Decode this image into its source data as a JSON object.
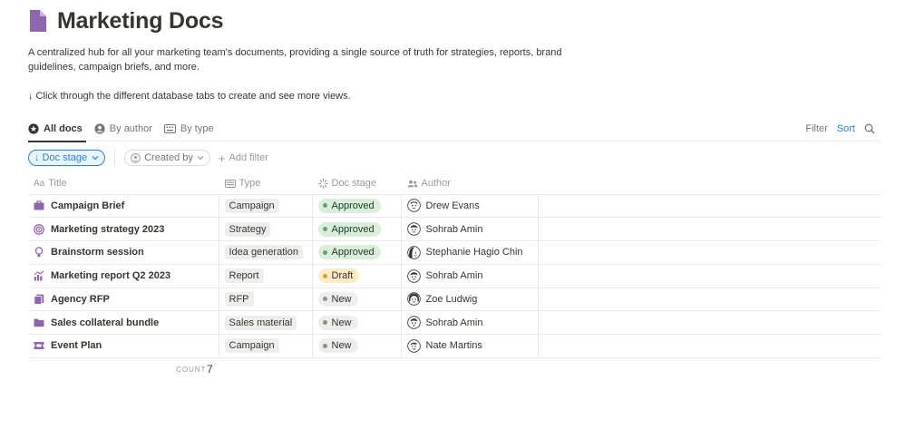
{
  "page": {
    "icon": "document-icon",
    "title": "Marketing Docs",
    "description": "A centralized hub for all your marketing team's documents, providing a single source of truth for strategies, reports, brand guidelines, campaign briefs, and more.",
    "hint": "↓ Click through the different database tabs to create and see more views."
  },
  "views": {
    "tabs": [
      {
        "label": "All docs",
        "icon": "star-circle-icon",
        "active": true
      },
      {
        "label": "By author",
        "icon": "person-icon",
        "active": false
      },
      {
        "label": "By type",
        "icon": "keyboard-icon",
        "active": false
      }
    ],
    "filter_label": "Filter",
    "sort_label": "Sort",
    "search_icon": "search-icon"
  },
  "filters": {
    "sort_chip": "↓ Doc stage",
    "created_by": "Created by",
    "add_filter": "Add filter"
  },
  "table": {
    "columns": [
      {
        "label": "Title",
        "icon_text": "Aa"
      },
      {
        "label": "Type",
        "icon": "list-icon"
      },
      {
        "label": "Doc stage",
        "icon": "loader-icon"
      },
      {
        "label": "Author",
        "icon": "people-icon"
      }
    ],
    "rows": [
      {
        "title": "Campaign Brief",
        "icon": "briefcase-icon",
        "type": "Campaign",
        "stage": "Approved",
        "author": "Drew Evans"
      },
      {
        "title": "Marketing strategy 2023",
        "icon": "target-icon",
        "type": "Strategy",
        "stage": "Approved",
        "author": "Sohrab Amin"
      },
      {
        "title": "Brainstorm session",
        "icon": "lightbulb-icon",
        "type": "Idea generation",
        "stage": "Approved",
        "author": "Stephanie Hagio Chin"
      },
      {
        "title": "Marketing report Q2 2023",
        "icon": "chart-icon",
        "type": "Report",
        "stage": "Draft",
        "author": "Sohrab Amin"
      },
      {
        "title": "Agency RFP",
        "icon": "documents-icon",
        "type": "RFP",
        "stage": "New",
        "author": "Zoe Ludwig"
      },
      {
        "title": "Sales collateral bundle",
        "icon": "folder-icon",
        "type": "Sales material",
        "stage": "New",
        "author": "Sohrab Amin"
      },
      {
        "title": "Event Plan",
        "icon": "ticket-icon",
        "type": "Campaign",
        "stage": "New",
        "author": "Nate Martins"
      }
    ],
    "count_label": "COUNT",
    "count_value": "7"
  },
  "colors": {
    "accent": "#2383e2",
    "icon_purple": "#9065b0",
    "approved_bg": "#dbeddb",
    "draft_bg": "#fdecc8",
    "new_bg": "#eeeeec"
  }
}
